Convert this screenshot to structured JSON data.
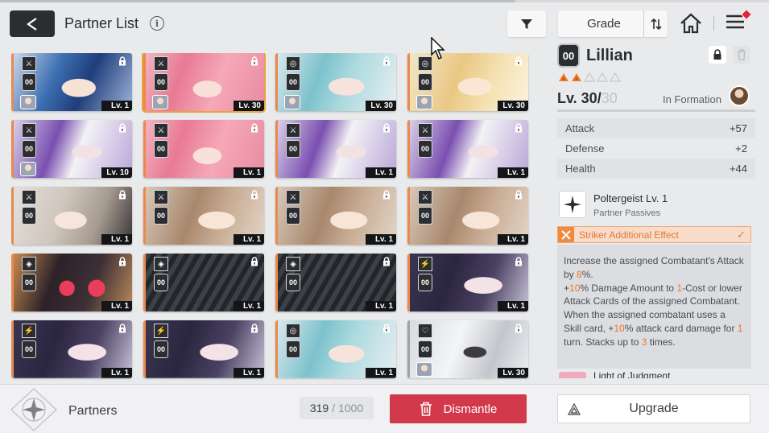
{
  "header": {
    "title": "Partner List",
    "grade_label": "Grade"
  },
  "colors": {
    "accent_orange": "#e8762a",
    "dismantle_red": "#d23a4c",
    "dark": "#2b2d31"
  },
  "cards": [
    {
      "lv": "Lv. 1",
      "rank": "00",
      "role": "crossed-swords",
      "bg": "blue-hair",
      "selected": false,
      "mini": true
    },
    {
      "lv": "Lv. 30",
      "rank": "00",
      "role": "crossed-swords",
      "bg": "pink-hair",
      "selected": true,
      "mini": true
    },
    {
      "lv": "Lv. 30",
      "rank": "00",
      "role": "target",
      "bg": "teal-hair",
      "selected": false,
      "mini": true
    },
    {
      "lv": "Lv. 30",
      "rank": "00",
      "role": "target",
      "bg": "blonde-hair",
      "selected": false,
      "mini": true
    },
    {
      "lv": "Lv. 10",
      "rank": "00",
      "role": "crossed-swords",
      "bg": "purple-hair",
      "selected": false,
      "mini": true
    },
    {
      "lv": "Lv. 1",
      "rank": "00",
      "role": "crossed-swords",
      "bg": "pink-hair",
      "selected": false,
      "mini": false
    },
    {
      "lv": "Lv. 1",
      "rank": "00",
      "role": "crossed-swords",
      "bg": "purple-hair",
      "selected": false,
      "mini": false
    },
    {
      "lv": "Lv. 1",
      "rank": "00",
      "role": "crossed-swords",
      "bg": "purple-hair",
      "selected": false,
      "mini": false
    },
    {
      "lv": "Lv. 1",
      "rank": "00",
      "role": "crossed-swords",
      "bg": "silver-hair",
      "selected": false,
      "mini": false
    },
    {
      "lv": "Lv. 1",
      "rank": "00",
      "role": "crossed-swords",
      "bg": "brown-hair",
      "selected": false,
      "mini": false
    },
    {
      "lv": "Lv. 1",
      "rank": "00",
      "role": "crossed-swords",
      "bg": "brown-hair",
      "selected": false,
      "mini": false
    },
    {
      "lv": "Lv. 1",
      "rank": "00",
      "role": "crossed-swords",
      "bg": "brown-hair",
      "selected": false,
      "mini": false
    },
    {
      "lv": "Lv. 1",
      "rank": "00",
      "role": "diamond",
      "bg": "black-creature",
      "selected": false,
      "mini": false
    },
    {
      "lv": "Lv. 1",
      "rank": "00",
      "role": "diamond",
      "bg": "dark-mech",
      "selected": false,
      "mini": false
    },
    {
      "lv": "Lv. 1",
      "rank": "00",
      "role": "diamond",
      "bg": "dark-mech",
      "selected": false,
      "mini": false
    },
    {
      "lv": "Lv. 1",
      "rank": "00",
      "role": "lightning",
      "bg": "glasses",
      "selected": false,
      "mini": false
    },
    {
      "lv": "Lv. 1",
      "rank": "00",
      "role": "lightning",
      "bg": "glasses",
      "selected": false,
      "mini": false
    },
    {
      "lv": "Lv. 1",
      "rank": "00",
      "role": "lightning",
      "bg": "glasses",
      "selected": false,
      "mini": false
    },
    {
      "lv": "Lv. 1",
      "rank": "00",
      "role": "target",
      "bg": "teal-hair",
      "selected": false,
      "mini": false
    },
    {
      "lv": "Lv. 30",
      "rank": "00",
      "role": "heart",
      "bg": "white-hair",
      "selected": false,
      "mini": true,
      "white": true
    }
  ],
  "detail": {
    "rank": "00",
    "name": "Lillian",
    "stars_filled": 2,
    "stars_total": 5,
    "level": "Lv. 30/",
    "level_max": "30",
    "formation_status": "In Formation",
    "stats": [
      {
        "label": "Attack",
        "value": "+57"
      },
      {
        "label": "Defense",
        "value": "+2"
      },
      {
        "label": "Health",
        "value": "+44"
      }
    ],
    "passive_name": "Poltergeist Lv. 1",
    "passive_sub": "Partner Passives",
    "effect_label": "Striker Additional Effect",
    "desc": {
      "p1a": "Increase the assigned Combatant's Attack by ",
      "p1b": "8",
      "p1c": "%.",
      "p2a": "+",
      "p2b": "10",
      "p2c": "% Damage Amount to ",
      "p2d": "1",
      "p2e": "-Cost or lower Attack Cards of the assigned Combatant.",
      "p3a": "When the assigned combatant uses a Skill card, +",
      "p3b": "10",
      "p3c": "% attack card damage for ",
      "p3d": "1",
      "p3e": " turn. Stacks up to ",
      "p3f": "3",
      "p3g": " times."
    },
    "next_text": "Light of Judgment"
  },
  "bottom": {
    "partners_label": "Partners",
    "count": "319",
    "count_max": "/ 1000",
    "dismantle": "Dismantle",
    "upgrade": "Upgrade"
  }
}
